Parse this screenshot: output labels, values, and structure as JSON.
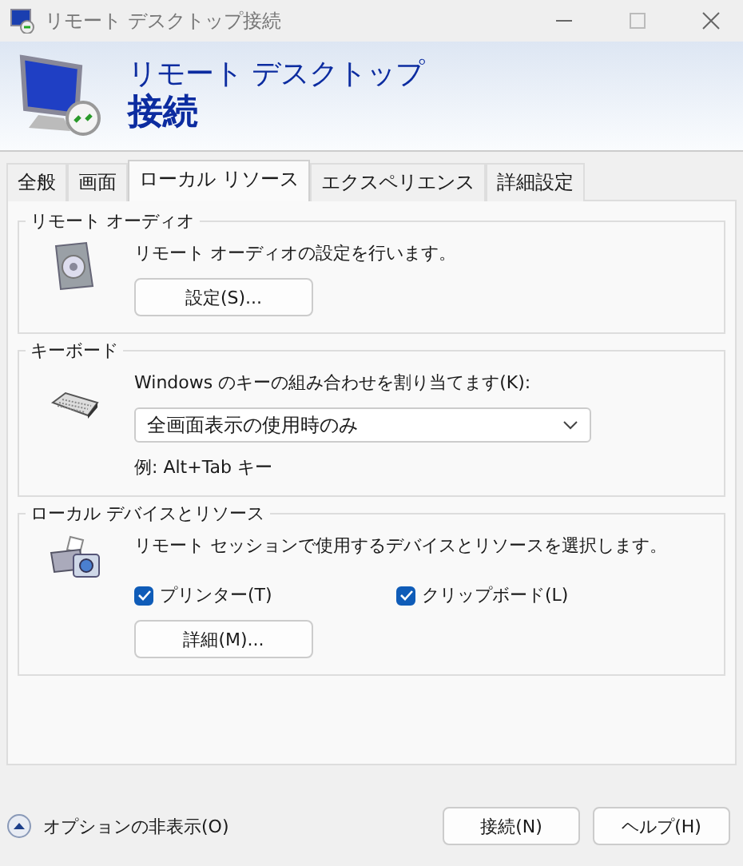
{
  "window": {
    "title": "リモート デスクトップ接続"
  },
  "banner": {
    "line1": "リモート デスクトップ",
    "line2": "接続"
  },
  "tabs": [
    {
      "label": "全般",
      "selected": false
    },
    {
      "label": "画面",
      "selected": false
    },
    {
      "label": "ローカル リソース",
      "selected": true
    },
    {
      "label": "エクスペリエンス",
      "selected": false
    },
    {
      "label": "詳細設定",
      "selected": false
    }
  ],
  "remote_audio": {
    "title": "リモート オーディオ",
    "description": "リモート オーディオの設定を行います。",
    "button": "設定(S)..."
  },
  "keyboard": {
    "title": "キーボード",
    "description": "Windows のキーの組み合わせを割り当てます(K):",
    "value": "全画面表示の使用時のみ",
    "example": "例: Alt+Tab キー"
  },
  "local_devices": {
    "title": "ローカル デバイスとリソース",
    "description": "リモート セッションで使用するデバイスとリソースを選択します。",
    "checkboxes": [
      {
        "label": "プリンター(T)",
        "checked": true
      },
      {
        "label": "クリップボード(L)",
        "checked": true
      }
    ],
    "button": "詳細(M)..."
  },
  "footer": {
    "options_toggle": "オプションの非表示(O)",
    "buttons": [
      "接続(N)",
      "ヘルプ(H)"
    ]
  }
}
